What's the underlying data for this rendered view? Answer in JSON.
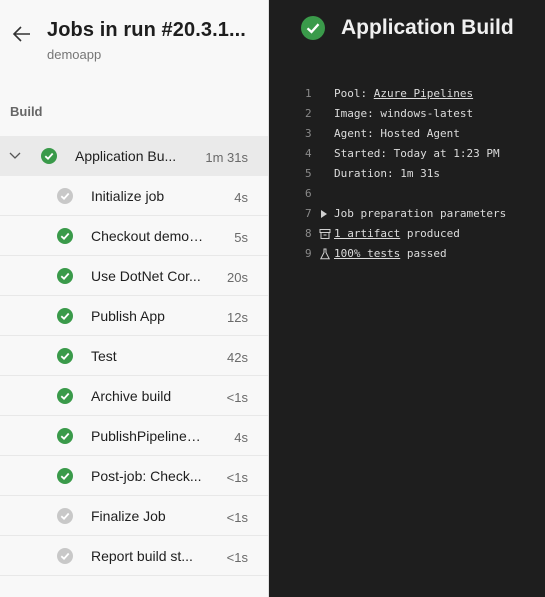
{
  "header": {
    "title": "Jobs in run #20.3.1...",
    "subtitle": "demoapp"
  },
  "section": "Build",
  "parent_job": {
    "label": "Application Bu...",
    "duration": "1m 31s",
    "status": "success"
  },
  "steps": [
    {
      "label": "Initialize job",
      "duration": "4s",
      "status": "neutral"
    },
    {
      "label": "Checkout demoa...",
      "duration": "5s",
      "status": "success"
    },
    {
      "label": "Use DotNet Cor...",
      "duration": "20s",
      "status": "success"
    },
    {
      "label": "Publish App",
      "duration": "12s",
      "status": "success"
    },
    {
      "label": "Test",
      "duration": "42s",
      "status": "success"
    },
    {
      "label": "Archive build",
      "duration": "<1s",
      "status": "success"
    },
    {
      "label": "PublishPipelineA...",
      "duration": "4s",
      "status": "success"
    },
    {
      "label": "Post-job: Check...",
      "duration": "<1s",
      "status": "success"
    },
    {
      "label": "Finalize Job",
      "duration": "<1s",
      "status": "neutral"
    },
    {
      "label": "Report build st...",
      "duration": "<1s",
      "status": "neutral"
    }
  ],
  "detail": {
    "title": "Application Build",
    "lines": [
      {
        "n": "1",
        "prefix": "Pool: ",
        "link": "Azure Pipelines",
        "suffix": ""
      },
      {
        "n": "2",
        "prefix": "Image: windows-latest",
        "link": "",
        "suffix": ""
      },
      {
        "n": "3",
        "prefix": "Agent: Hosted Agent",
        "link": "",
        "suffix": ""
      },
      {
        "n": "4",
        "prefix": "Started: Today at 1:23 PM",
        "link": "",
        "suffix": ""
      },
      {
        "n": "5",
        "prefix": "Duration: 1m 31s",
        "link": "",
        "suffix": ""
      },
      {
        "n": "6",
        "prefix": "",
        "link": "",
        "suffix": ""
      },
      {
        "n": "7",
        "prefix": "Job preparation parameters",
        "link": "",
        "suffix": ""
      },
      {
        "n": "8",
        "prefix": "",
        "link": "1 artifact",
        "suffix": " produced"
      },
      {
        "n": "9",
        "prefix": "",
        "link": "100% tests",
        "suffix": " passed"
      }
    ]
  },
  "colors": {
    "success": "#3a9a4a",
    "neutral": "#c8c8c8"
  }
}
